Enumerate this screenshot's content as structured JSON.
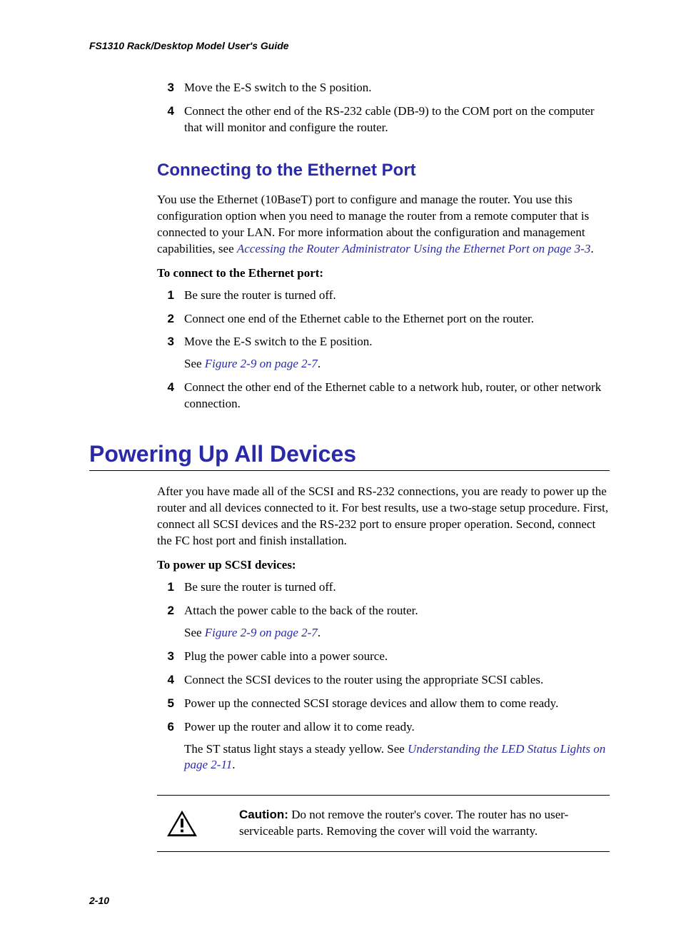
{
  "running_head": "FS1310 Rack/Desktop Model User's Guide",
  "top_list": {
    "item3": {
      "n": "3",
      "text": "Move the E-S switch to the S position."
    },
    "item4": {
      "n": "4",
      "text": "Connect the other end of the RS-232 cable (DB-9) to the COM port on the computer that will monitor and configure the router."
    }
  },
  "ethernet": {
    "heading": "Connecting to the Ethernet Port",
    "intro_a": "You use the Ethernet (10BaseT) port to configure and manage the router. You use this configuration option when you need to manage the router from a remote computer that is connected to your LAN. For more information about the configuration and management capabilities, see ",
    "intro_link": "Accessing the Router Administrator Using the Ethernet Port on page 3-3",
    "intro_b": ".",
    "lead": "To connect to the Ethernet port:",
    "steps": {
      "s1": {
        "n": "1",
        "text": "Be sure the router is turned off."
      },
      "s2": {
        "n": "2",
        "text": "Connect one end of the Ethernet cable to the Ethernet port on the router."
      },
      "s3": {
        "n": "3",
        "text": "Move the E-S switch to the E position.",
        "see_a": "See ",
        "see_link": "Figure 2-9 on page 2-7",
        "see_b": "."
      },
      "s4": {
        "n": "4",
        "text": "Connect the other end of the Ethernet cable to a network hub, router, or other network connection."
      }
    }
  },
  "power": {
    "heading": "Powering Up All Devices",
    "intro": "After you have made all of the SCSI and RS-232 connections, you are ready to power up the router and all devices connected to it. For best results, use a two-stage setup procedure. First, connect all SCSI devices and the RS-232 port to ensure proper operation. Second, connect the FC host port and finish installation.",
    "lead": "To power up SCSI devices:",
    "steps": {
      "s1": {
        "n": "1",
        "text": "Be sure the router is turned off."
      },
      "s2": {
        "n": "2",
        "text": "Attach the power cable to the back of the router.",
        "see_a": "See ",
        "see_link": "Figure 2-9 on page 2-7",
        "see_b": "."
      },
      "s3": {
        "n": "3",
        "text": "Plug the power cable into a power source."
      },
      "s4": {
        "n": "4",
        "text": "Connect the SCSI devices to the router using the appropriate SCSI cables."
      },
      "s5": {
        "n": "5",
        "text": "Power up the connected SCSI storage devices and allow them to come ready."
      },
      "s6": {
        "n": "6",
        "text": "Power up the router and allow it to come ready.",
        "extra_a": "The ST status light stays a steady yellow. See ",
        "extra_link": "Understanding the LED Status Lights on page 2-11",
        "extra_b": "."
      }
    }
  },
  "caution": {
    "label": "Caution:",
    "text": " Do not remove the router's cover. The router has no user-serviceable parts. Removing the cover will void the warranty."
  },
  "page_number": "2-10"
}
